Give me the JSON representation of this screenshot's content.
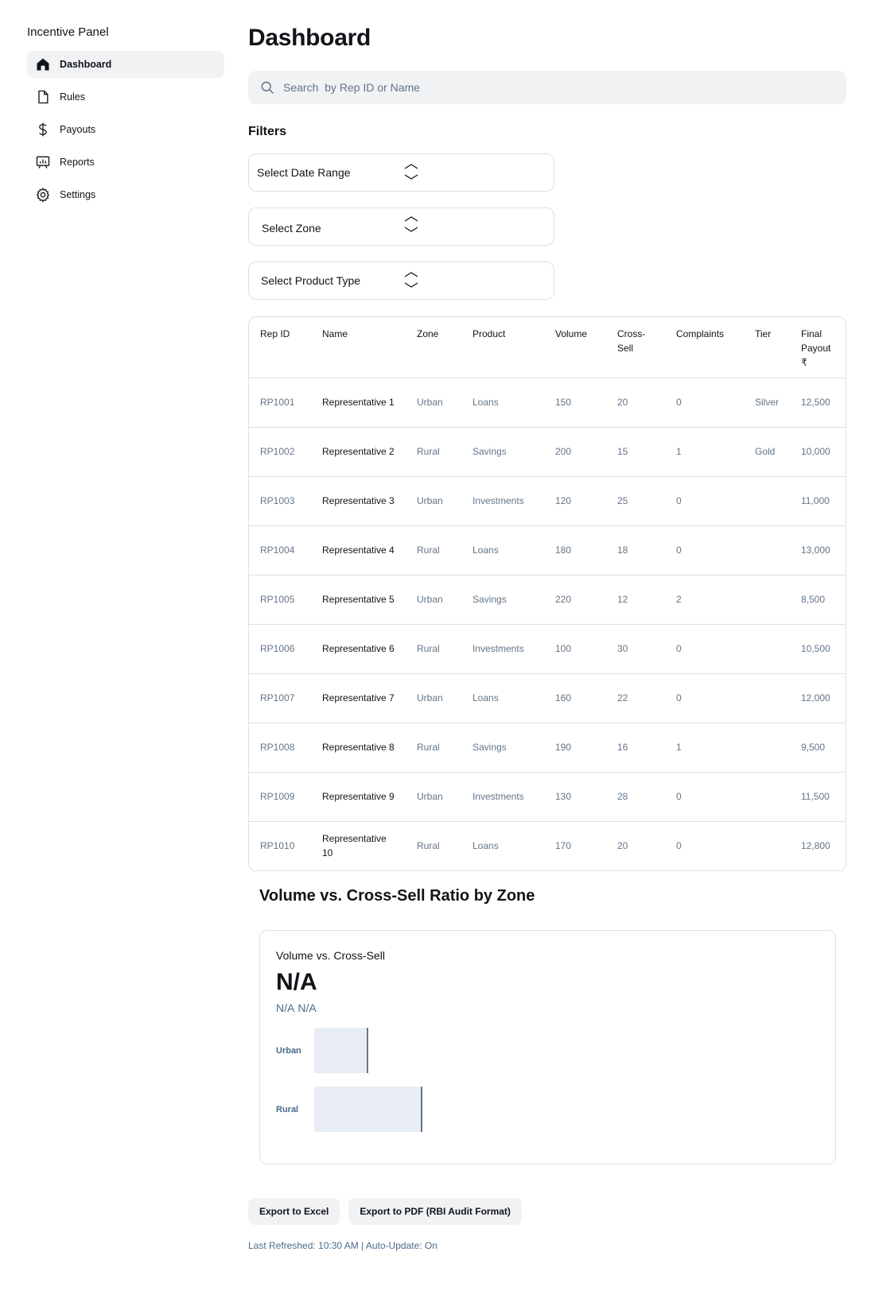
{
  "sidebar": {
    "brand": "Incentive Panel",
    "items": [
      {
        "label": "Dashboard",
        "icon": "house-icon"
      },
      {
        "label": "Rules",
        "icon": "file-icon"
      },
      {
        "label": "Payouts",
        "icon": "dollar-icon"
      },
      {
        "label": "Reports",
        "icon": "presentation-chart-icon"
      },
      {
        "label": "Settings",
        "icon": "gear-icon"
      }
    ]
  },
  "main": {
    "title": "Dashboard",
    "search": {
      "placeholder": "Search  by Rep ID or Name"
    },
    "filters": {
      "title": "Filters",
      "date_range": "Select  Date  Range",
      "zone": "Select  Zone",
      "product_type": "Select  Product  Type"
    },
    "table": {
      "headers": [
        "Rep ID",
        "Name",
        "Zone",
        "Product",
        "Volume",
        "Cross-Sell",
        "Complaints",
        "Tier",
        "Final Payout ₹"
      ],
      "rows": [
        [
          "RP1001",
          "Representative 1",
          "Urban",
          "Loans",
          "150",
          "20",
          "0",
          "Silver",
          "12,500"
        ],
        [
          "RP1002",
          "Representative 2",
          "Rural",
          "Savings",
          "200",
          "15",
          "1",
          "Gold",
          "10,000"
        ],
        [
          "RP1003",
          "Representative 3",
          "Urban",
          "Investments",
          "120",
          "25",
          "0",
          "",
          "11,000"
        ],
        [
          "RP1004",
          "Representative 4",
          "Rural",
          "Loans",
          "180",
          "18",
          "0",
          "",
          "13,000"
        ],
        [
          "RP1005",
          "Representative 5",
          "Urban",
          "Savings",
          "220",
          "12",
          "2",
          "",
          "8,500"
        ],
        [
          "RP1006",
          "Representative 6",
          "Rural",
          "Investments",
          "100",
          "30",
          "0",
          "",
          "10,500"
        ],
        [
          "RP1007",
          "Representative 7",
          "Urban",
          "Loans",
          "160",
          "22",
          "0",
          "",
          "12,000"
        ],
        [
          "RP1008",
          "Representative 8",
          "Rural",
          "Savings",
          "190",
          "16",
          "1",
          "",
          "9,500"
        ],
        [
          "RP1009",
          "Representative 9",
          "Urban",
          "Investments",
          "130",
          "28",
          "0",
          "",
          "11,500"
        ],
        [
          "RP1010",
          "Representative 10",
          "Rural",
          "Loans",
          "170",
          "20",
          "0",
          "",
          "12,800"
        ]
      ]
    },
    "chart_section": {
      "title": "Volume vs. Cross-Sell Ratio by Zone",
      "card_label": "Volume vs. Cross-Sell",
      "value": "N/A",
      "sub_values": [
        "N/A",
        "N/A"
      ]
    },
    "actions": {
      "export_excel": "Export to Excel",
      "export_pdf": "Export to PDF (RBI Audit Format)"
    },
    "refresh": "Last Refreshed: 10:30 AM | Auto-Update: On"
  },
  "chart_data": {
    "type": "bar",
    "orientation": "horizontal",
    "categories": [
      "Urban",
      "Rural"
    ],
    "values": [
      0.5,
      1.0
    ],
    "title": "Volume vs. Cross-Sell",
    "xlabel": "",
    "ylabel": ""
  },
  "colors": {
    "accent_text": "#4a6a8a",
    "muted_text": "#637588",
    "surface": "#f0f2f4",
    "border": "#dce0e5",
    "bar_fill": "#e8edf3"
  }
}
